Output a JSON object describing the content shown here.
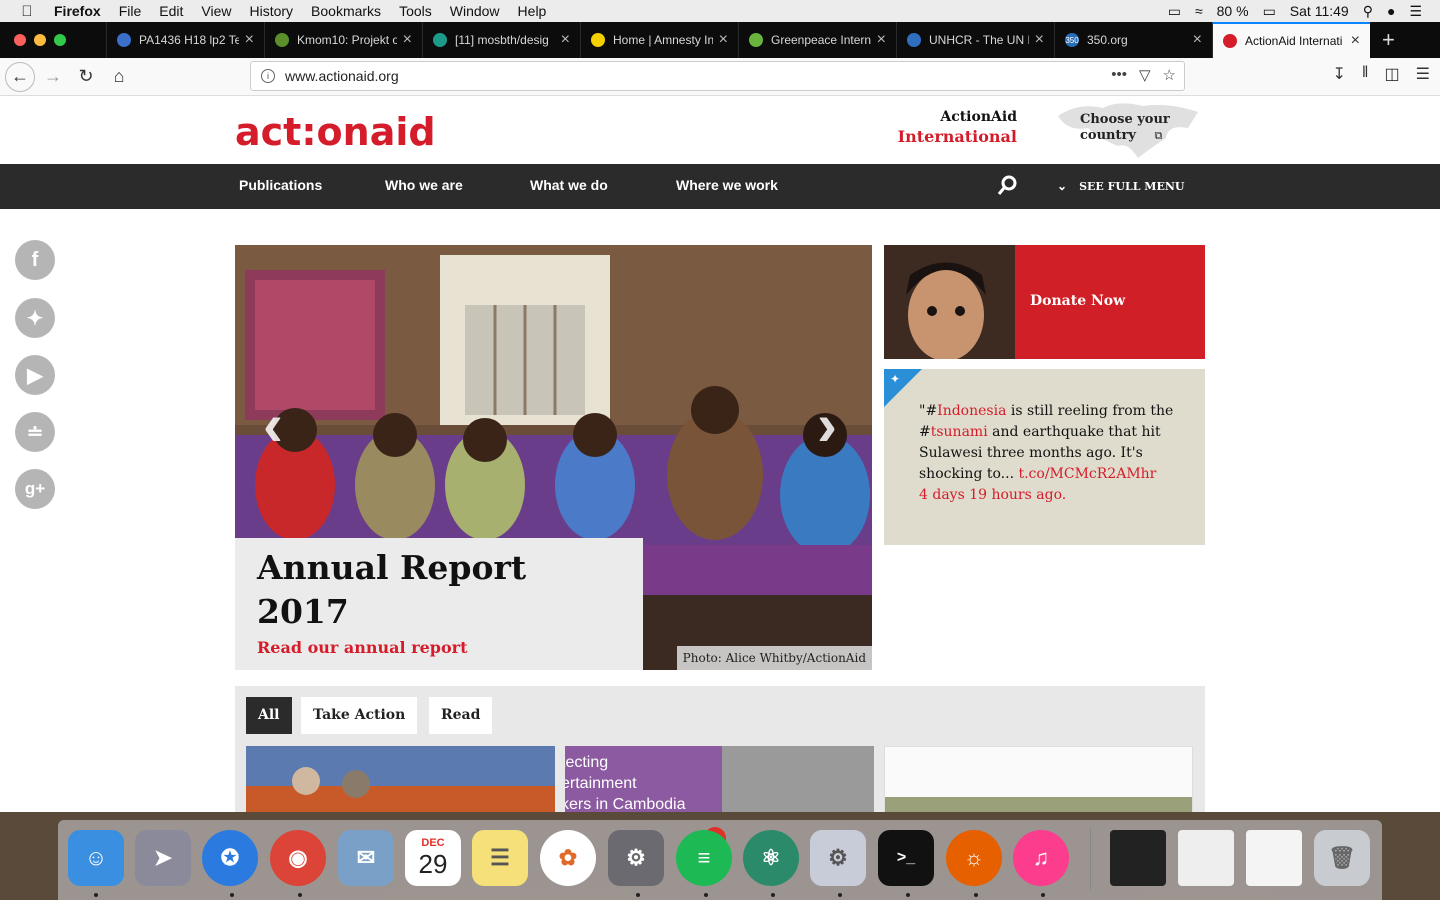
{
  "menubar": {
    "app": "Firefox",
    "items": [
      "File",
      "Edit",
      "View",
      "History",
      "Bookmarks",
      "Tools",
      "Window",
      "Help"
    ],
    "battery": "80 %",
    "clock": "Sat 11:49"
  },
  "tabs": [
    {
      "title": "PA1436 H18 lp2 Te",
      "color": "#3b6fc9"
    },
    {
      "title": "Kmom10: Projekt o",
      "color": "#5a8f2a"
    },
    {
      "title": "[11] mosbth/desig",
      "color": "#1d9b8a"
    },
    {
      "title": "Home | Amnesty In",
      "color": "#f5d000"
    },
    {
      "title": "Greenpeace Intern",
      "color": "#6ab43e"
    },
    {
      "title": "UNHCR - The UN R",
      "color": "#2f6fc2"
    },
    {
      "title": "350.org",
      "color": "#2a6db7",
      "fav_text": "350"
    },
    {
      "title": "ActionAid Internati",
      "color": "#d51c2a",
      "active": true
    }
  ],
  "url": "www.actionaid.org",
  "header": {
    "logo": "act:onaid",
    "intl_line1": "ActionAid",
    "intl_line2": "International",
    "country_line1": "Choose your",
    "country_line2": "country"
  },
  "nav": {
    "items": [
      "Publications",
      "Who we are",
      "What we do",
      "Where we work"
    ],
    "full_menu": "SEE FULL MENU"
  },
  "social": [
    "facebook-icon",
    "twitter-icon",
    "youtube-icon",
    "rss-icon",
    "google-plus-icon"
  ],
  "hero": {
    "title_line1": "Annual Report",
    "title_line2": "2017",
    "link": "Read our annual report",
    "credit": "Photo: Alice Whitby/ActionAid"
  },
  "donate": {
    "label": "Donate Now"
  },
  "tweet": {
    "p1": "\"#",
    "tag1": "Indonesia",
    "p2": " is still reeling from the #",
    "tag2": "tsunami",
    "p3": " and earthquake that hit Sulawesi three months ago. It's shocking to... ",
    "link": "t.co/MCMcR2AMhr",
    "time": "4 days 19 hours ago."
  },
  "filters": [
    "All",
    "Take Action",
    "Read"
  ],
  "card2_lines": [
    "tecting",
    "ertainment",
    "kers in Cambodia"
  ],
  "dock": {
    "calendar_month": "DEC",
    "calendar_day": "29",
    "settings_badge": "1"
  }
}
